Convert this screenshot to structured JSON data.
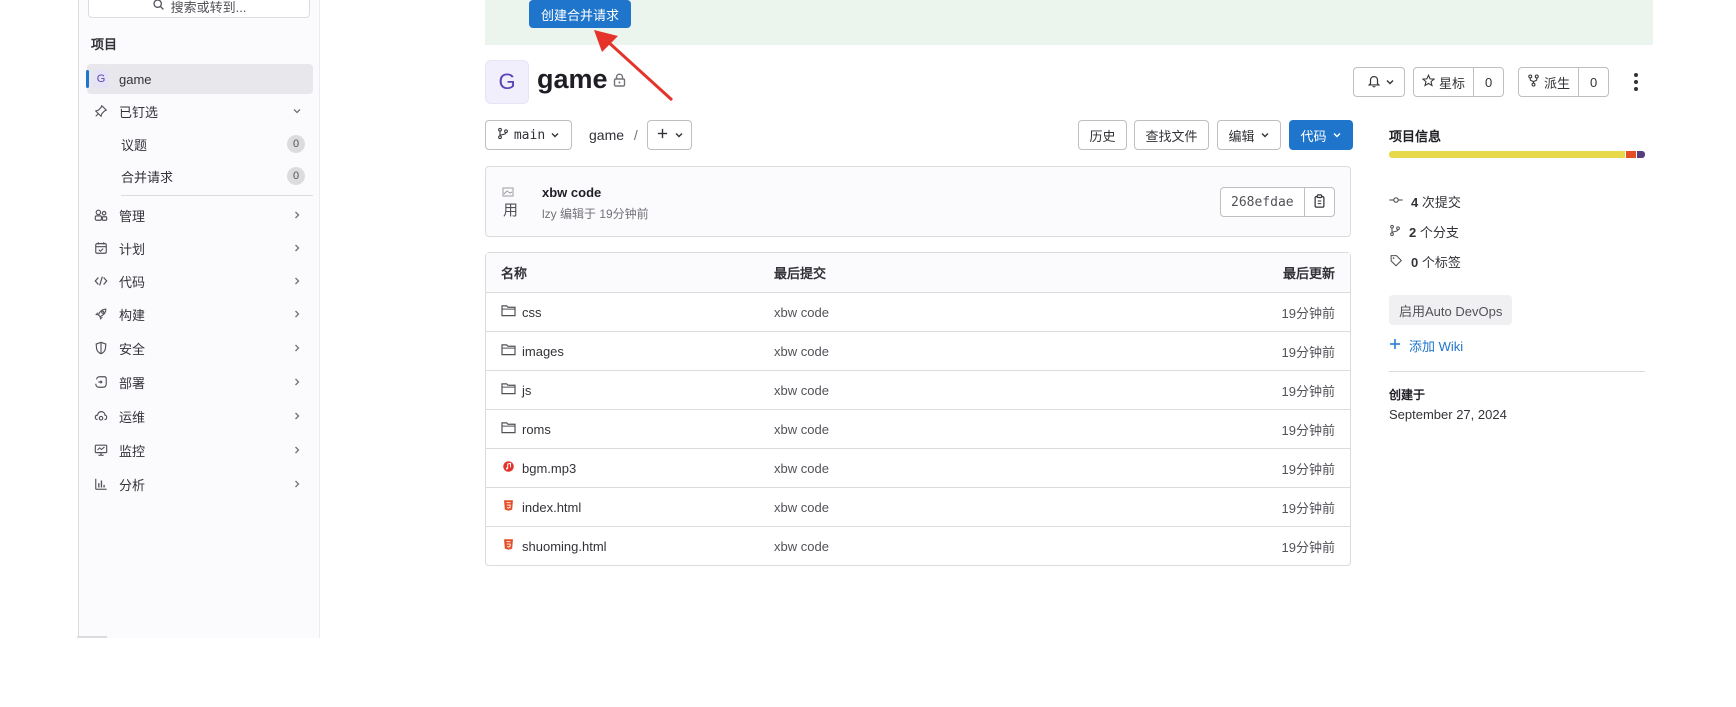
{
  "sidebar": {
    "search_placeholder": "搜索或转到...",
    "section_title": "项目",
    "project_avatar_letter": "G",
    "project_name": "game",
    "items": [
      {
        "label": "已钉选",
        "icon": "pin-icon"
      },
      {
        "label": "管理",
        "icon": "users-icon"
      },
      {
        "label": "计划",
        "icon": "calendar-icon"
      },
      {
        "label": "代码",
        "icon": "code-icon"
      },
      {
        "label": "构建",
        "icon": "rocket-icon"
      },
      {
        "label": "安全",
        "icon": "shield-icon"
      },
      {
        "label": "部署",
        "icon": "deploy-icon"
      },
      {
        "label": "运维",
        "icon": "cloud-gear-icon"
      },
      {
        "label": "监控",
        "icon": "monitor-icon"
      },
      {
        "label": "分析",
        "icon": "chart-icon"
      }
    ],
    "pinned_children": [
      {
        "label": "议题",
        "count": "0"
      },
      {
        "label": "合并请求",
        "count": "0"
      }
    ]
  },
  "banner": {
    "create_mr_label": "创建合并请求",
    "color": "#ecf4ee"
  },
  "project": {
    "avatar_letter": "G",
    "title": "game",
    "notify_label": "",
    "star_label": "星标",
    "star_count": "0",
    "fork_label": "派生",
    "fork_count": "0"
  },
  "toolbar": {
    "branch": "main",
    "path": "game",
    "path_sep": "/",
    "history_label": "历史",
    "find_file_label": "查找文件",
    "edit_label": "编辑",
    "code_label": "代码"
  },
  "commit": {
    "title": "xbw code",
    "meta": "lzy 编辑于 19分钟前",
    "avatar_alt": "用",
    "sha": "268efdae"
  },
  "files": {
    "headers": {
      "name": "名称",
      "last_commit": "最后提交",
      "last_update": "最后更新"
    },
    "rows": [
      {
        "name": "css",
        "type": "folder",
        "commit": "xbw code",
        "updated": "19分钟前"
      },
      {
        "name": "images",
        "type": "folder",
        "commit": "xbw code",
        "updated": "19分钟前"
      },
      {
        "name": "js",
        "type": "folder",
        "commit": "xbw code",
        "updated": "19分钟前"
      },
      {
        "name": "roms",
        "type": "folder",
        "commit": "xbw code",
        "updated": "19分钟前"
      },
      {
        "name": "bgm.mp3",
        "type": "audio",
        "commit": "xbw code",
        "updated": "19分钟前"
      },
      {
        "name": "index.html",
        "type": "html",
        "commit": "xbw code",
        "updated": "19分钟前"
      },
      {
        "name": "shuoming.html",
        "type": "html",
        "commit": "xbw code",
        "updated": "19分钟前"
      }
    ]
  },
  "project_info": {
    "title": "项目信息",
    "languages": [
      {
        "color": "#e8d94a",
        "share": 0.93
      },
      {
        "color": "#e44d26",
        "share": 0.04
      },
      {
        "color": "#563d7c",
        "share": 0.03
      }
    ],
    "commits_count": "4",
    "commits_label": "次提交",
    "branches_count": "2",
    "branches_label": "个分支",
    "tags_count": "0",
    "tags_label": "个标签",
    "auto_devops_label": "启用Auto DevOps",
    "add_wiki_label": "添加 Wiki",
    "created_label": "创建于",
    "created_date": "September 27, 2024"
  },
  "colors": {
    "accent": "#1f75cb",
    "arrow": "#e5332a"
  }
}
